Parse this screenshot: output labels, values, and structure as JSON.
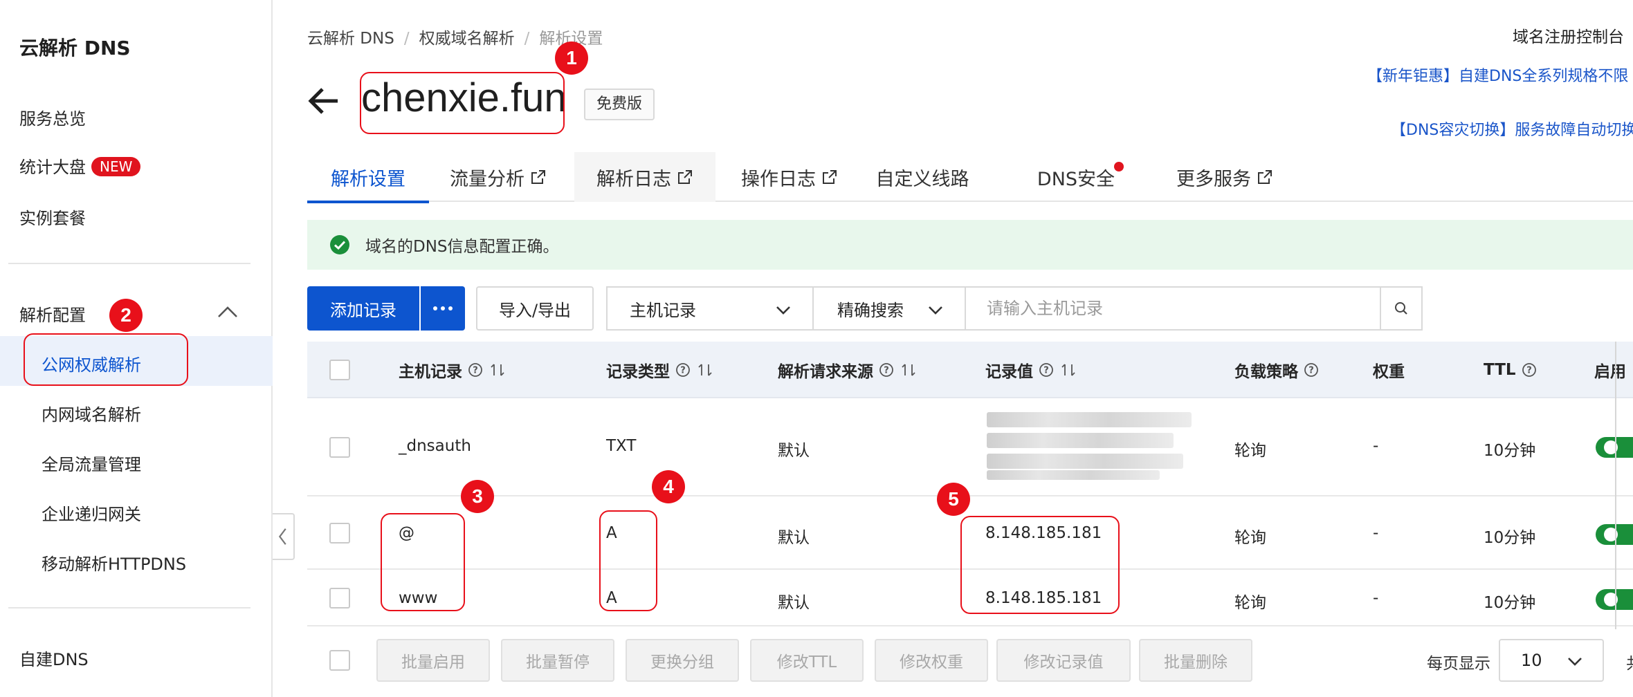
{
  "sidebar": {
    "title": "云解析 DNS",
    "items": [
      {
        "label": "服务总览"
      },
      {
        "label": "统计大盘",
        "badge": "NEW"
      },
      {
        "label": "实例套餐"
      }
    ],
    "section": "解析配置",
    "sub_items": [
      {
        "label": "公网权威解析"
      },
      {
        "label": "内网域名解析"
      },
      {
        "label": "全局流量管理"
      },
      {
        "label": "企业递归网关"
      },
      {
        "label": "移动解析HTTPDNS"
      }
    ],
    "footer_item": "自建DNS"
  },
  "breadcrumb": [
    "云解析 DNS",
    "权威域名解析",
    "解析设置"
  ],
  "top_right_link": "域名注册控制台",
  "domain": "chenxie.fun",
  "plan_badge": "免费版",
  "promos": [
    "【新年钜惠】自建DNS全系列规格不限",
    "【DNS容灾切换】服务故障自动切换"
  ],
  "tabs": [
    {
      "label": "解析设置"
    },
    {
      "label": "流量分析"
    },
    {
      "label": "解析日志"
    },
    {
      "label": "操作日志"
    },
    {
      "label": "自定义线路"
    },
    {
      "label": "DNS安全"
    },
    {
      "label": "更多服务"
    }
  ],
  "alert": "域名的DNS信息配置正确。",
  "toolbar": {
    "add_record": "添加记录",
    "import_export": "导入/导出",
    "field_select": "主机记录",
    "mode_select": "精确搜索",
    "search_placeholder": "请输入主机记录"
  },
  "table": {
    "headers": [
      "主机记录",
      "记录类型",
      "解析请求来源",
      "记录值",
      "负载策略",
      "权重",
      "TTL",
      "启用"
    ],
    "rows": [
      {
        "host": "_dnsauth",
        "type": "TXT",
        "source": "默认",
        "value": "",
        "strategy": "轮询",
        "weight": "-",
        "ttl": "10分钟"
      },
      {
        "host": "@",
        "type": "A",
        "source": "默认",
        "value": "8.148.185.181",
        "strategy": "轮询",
        "weight": "-",
        "ttl": "10分钟"
      },
      {
        "host": "www",
        "type": "A",
        "source": "默认",
        "value": "8.148.185.181",
        "strategy": "轮询",
        "weight": "-",
        "ttl": "10分钟"
      }
    ]
  },
  "batch_actions": [
    "批量启用",
    "批量暂停",
    "更换分组",
    "修改TTL",
    "修改权重",
    "修改记录值",
    "批量删除"
  ],
  "pagination": {
    "label": "每页显示",
    "page_size": "10",
    "edge_text": "共"
  },
  "annotations": [
    "1",
    "2",
    "3",
    "4",
    "5"
  ],
  "colors": {
    "primary": "#0d55cf",
    "annotation": "#e8101a",
    "success": "#1a8f3a",
    "badge": "#e0141e"
  }
}
